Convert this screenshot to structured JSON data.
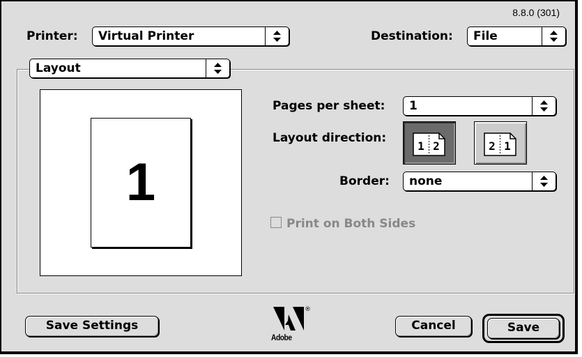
{
  "version": "8.8.0 (301)",
  "printer": {
    "label": "Printer:",
    "value": "Virtual Printer"
  },
  "destination": {
    "label": "Destination:",
    "value": "File"
  },
  "panel": {
    "value": "Layout"
  },
  "preview": {
    "page_number": "1"
  },
  "layout": {
    "pages_per_sheet_label": "Pages per sheet:",
    "pages_per_sheet_value": "1",
    "direction_label": "Layout direction:",
    "direction_ltr": [
      "1",
      "2"
    ],
    "direction_rtl": [
      "2",
      "1"
    ],
    "direction_selected": "left-to-right",
    "border_label": "Border:",
    "border_value": "none"
  },
  "duplex": {
    "label": "Print on Both Sides",
    "checked": false,
    "enabled": false
  },
  "footer": {
    "save_settings_label": "Save Settings",
    "brand": "Adobe",
    "cancel_label": "Cancel",
    "save_label": "Save"
  }
}
